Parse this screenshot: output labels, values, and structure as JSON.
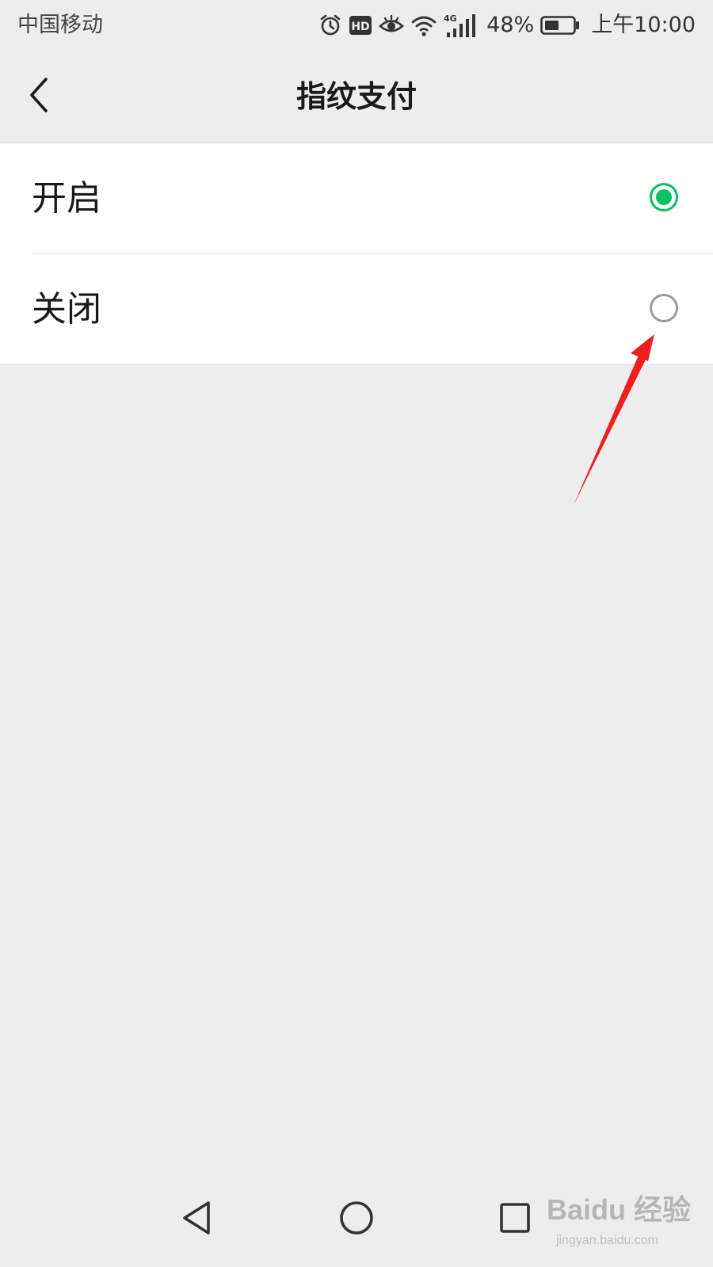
{
  "status_bar": {
    "carrier": "中国移动",
    "network": "4G",
    "battery_percent": "48%",
    "time": "上午10:00",
    "icons": [
      "alarm-icon",
      "hd-icon",
      "eye-comfort-icon",
      "wifi-icon",
      "signal-icon",
      "battery-icon"
    ]
  },
  "header": {
    "title": "指纹支付",
    "back_icon": "chevron-left-icon"
  },
  "options": [
    {
      "label": "开启",
      "selected": true
    },
    {
      "label": "关闭",
      "selected": false
    }
  ],
  "colors": {
    "accent": "#07c160",
    "background": "#ededed",
    "annotation": "#f01e1e"
  },
  "nav_bar": {
    "icons": [
      "nav-back-icon",
      "nav-home-icon",
      "nav-recent-icon"
    ]
  },
  "watermark": {
    "text": "Baidu 经验",
    "url_text": "jingyan.baidu.com"
  }
}
